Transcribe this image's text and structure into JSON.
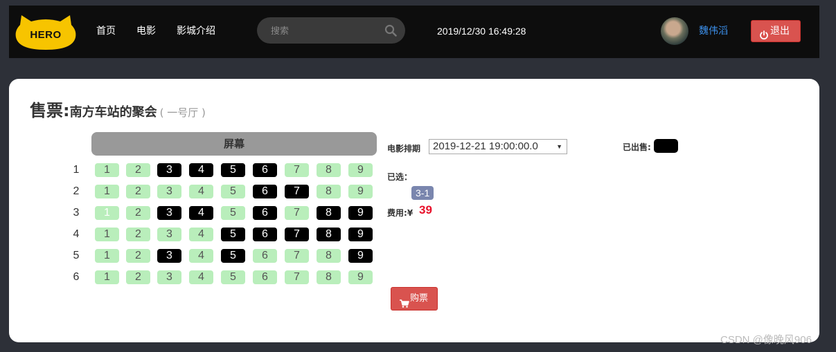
{
  "navbar": {
    "logo_text": "HERO",
    "links": [
      "首页",
      "电影",
      "影城介绍"
    ],
    "search_placeholder": "搜索",
    "clock": "2019/12/30 16:49:28",
    "username": "魏伟滔",
    "logout_label": "退出"
  },
  "page": {
    "title_prefix": "售票:",
    "movie_name": "南方车站的聚会",
    "hall": "( 一号厅 )",
    "screen_label": "屏幕"
  },
  "seat_map": {
    "rows": [
      "1",
      "2",
      "3",
      "4",
      "5",
      "6"
    ],
    "seat_labels": [
      "1",
      "2",
      "3",
      "4",
      "5",
      "6",
      "7",
      "8",
      "9"
    ],
    "status_legend": {
      "a": "available",
      "s": "sold",
      "x": "selected"
    },
    "status": [
      [
        "a",
        "a",
        "s",
        "s",
        "s",
        "s",
        "a",
        "a",
        "a"
      ],
      [
        "a",
        "a",
        "a",
        "a",
        "a",
        "s",
        "s",
        "a",
        "a"
      ],
      [
        "x",
        "a",
        "s",
        "s",
        "a",
        "s",
        "a",
        "s",
        "s"
      ],
      [
        "a",
        "a",
        "a",
        "a",
        "s",
        "s",
        "s",
        "s",
        "s"
      ],
      [
        "a",
        "a",
        "s",
        "a",
        "s",
        "a",
        "a",
        "a",
        "s"
      ],
      [
        "a",
        "a",
        "a",
        "a",
        "a",
        "a",
        "a",
        "a",
        "a"
      ]
    ],
    "colors": {
      "available": "#b9eebb",
      "sold": "#000000",
      "accent": "#d9534f"
    }
  },
  "sidebar": {
    "schedule_label": "电影排期",
    "schedule_value": "2019-12-21 19:00:00.0",
    "sold_label": "已出售:",
    "selected_label": "已选：",
    "selected_seats": [
      "3-1"
    ],
    "fee_label": "费用:",
    "currency": "¥",
    "fee_value": "39",
    "buy_label": "购票"
  },
  "watermark": "CSDN @像晚风906"
}
